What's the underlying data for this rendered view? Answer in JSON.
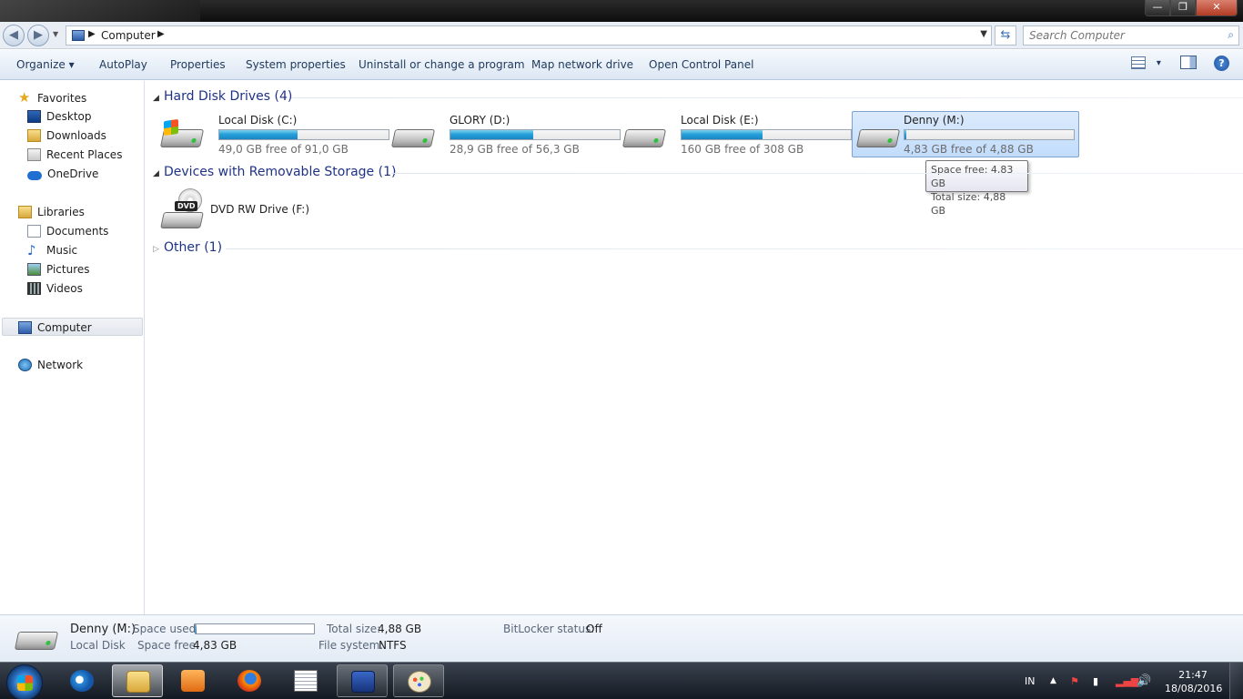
{
  "window": {
    "minimize": "—",
    "maximize": "❐",
    "close": "✕"
  },
  "address": {
    "crumb": "Computer",
    "search_placeholder": "Search Computer"
  },
  "toolbar": {
    "organize": "Organize ▾",
    "autoplay": "AutoPlay",
    "properties": "Properties",
    "system_properties": "System properties",
    "uninstall": "Uninstall or change a program",
    "map_network": "Map network drive",
    "control_panel": "Open Control Panel",
    "view_arrow": "▾",
    "help": "?"
  },
  "nav": {
    "favorites": "Favorites",
    "desktop": "Desktop",
    "downloads": "Downloads",
    "recent_places": "Recent Places",
    "onedrive": "OneDrive",
    "libraries": "Libraries",
    "documents": "Documents",
    "music": "Music",
    "pictures": "Pictures",
    "videos": "Videos",
    "computer": "Computer",
    "network": "Network"
  },
  "groups": {
    "hdd": "Hard Disk Drives (4)",
    "removable": "Devices with Removable Storage (1)",
    "other": "Other (1)"
  },
  "drives": [
    {
      "name": "Local Disk (C:)",
      "free": "49,0 GB free of 91,0 GB",
      "used_fraction": 0.46
    },
    {
      "name": "GLORY (D:)",
      "free": "28,9 GB free of 56,3 GB",
      "used_fraction": 0.49
    },
    {
      "name": "Local Disk (E:)",
      "free": "160 GB free of 308 GB",
      "used_fraction": 0.48
    },
    {
      "name": "Denny (M:)",
      "free": "4,83 GB free of 4,88 GB",
      "used_fraction": 0.01
    }
  ],
  "dvd": {
    "name": "DVD RW Drive (F:)",
    "badge": "DVD"
  },
  "tooltip": {
    "line1": "Space free: 4,83 GB",
    "line2": "Total size: 4,88 GB"
  },
  "details": {
    "name": "Denny (M:)",
    "type": "Local Disk",
    "space_used_label": "Space used:",
    "space_used_fraction": 0.01,
    "space_free_label": "Space free:",
    "space_free": "4,83 GB",
    "total_size_label": "Total size:",
    "total_size": "4,88 GB",
    "file_system_label": "File system:",
    "file_system": "NTFS",
    "bitlocker_label": "BitLocker status:",
    "bitlocker": "Off"
  },
  "taskbar": {
    "language": "IN",
    "time": "21:47",
    "date": "18/08/2016"
  }
}
